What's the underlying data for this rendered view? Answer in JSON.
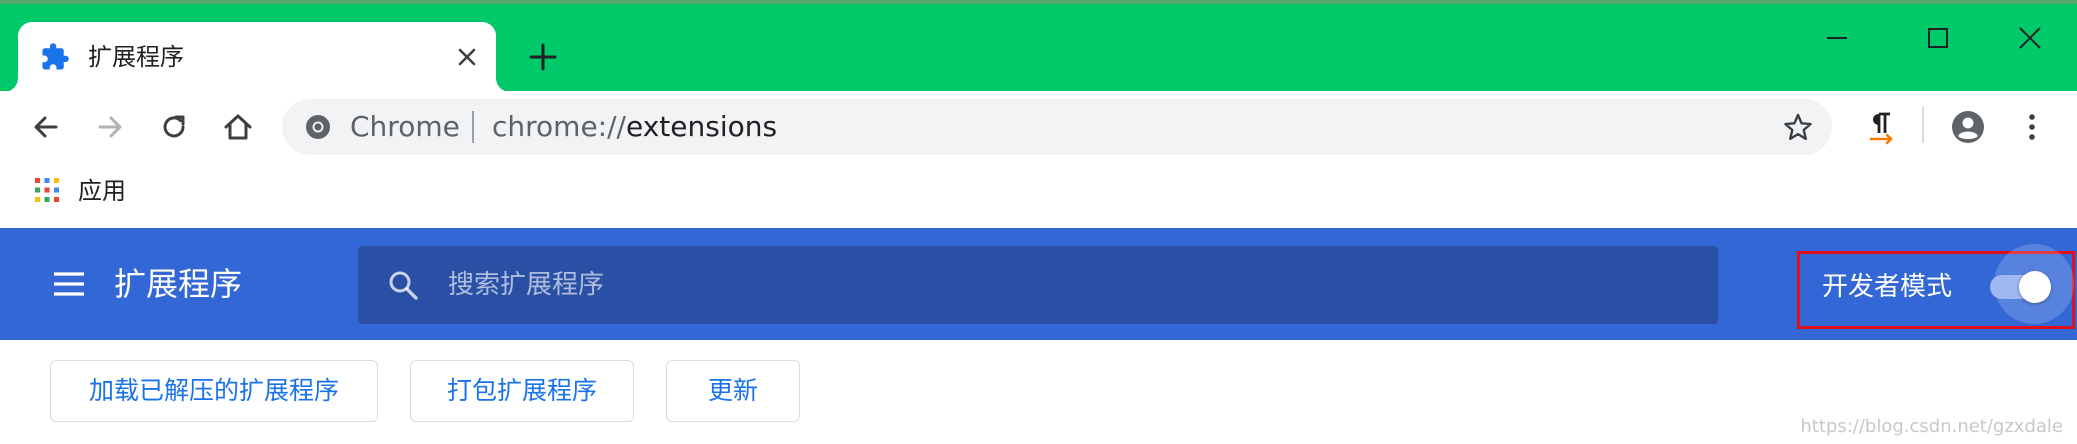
{
  "browser": {
    "tab": {
      "title": "扩展程序",
      "icon": "puzzle-icon"
    },
    "address_bar": {
      "site_label": "Chrome",
      "url_scheme": "chrome://",
      "url_path": "extensions"
    },
    "bookmarks": [
      {
        "label": "应用",
        "icon": "apps-grid-icon"
      }
    ]
  },
  "extensions_page": {
    "header_title": "扩展程序",
    "search": {
      "placeholder": "搜索扩展程序",
      "value": ""
    },
    "developer_mode": {
      "label": "开发者模式",
      "enabled": true
    }
  },
  "actions": [
    {
      "label": "加载已解压的扩展程序"
    },
    {
      "label": "打包扩展程序"
    },
    {
      "label": "更新"
    }
  ],
  "watermark": "https://blog.csdn.net/gzxdale",
  "colors": {
    "titlebar": "#00c96a",
    "header": "#3367d6",
    "search_bg": "#2a50a6",
    "accent": "#1a73e8",
    "highlight_box": "#e0101a"
  }
}
